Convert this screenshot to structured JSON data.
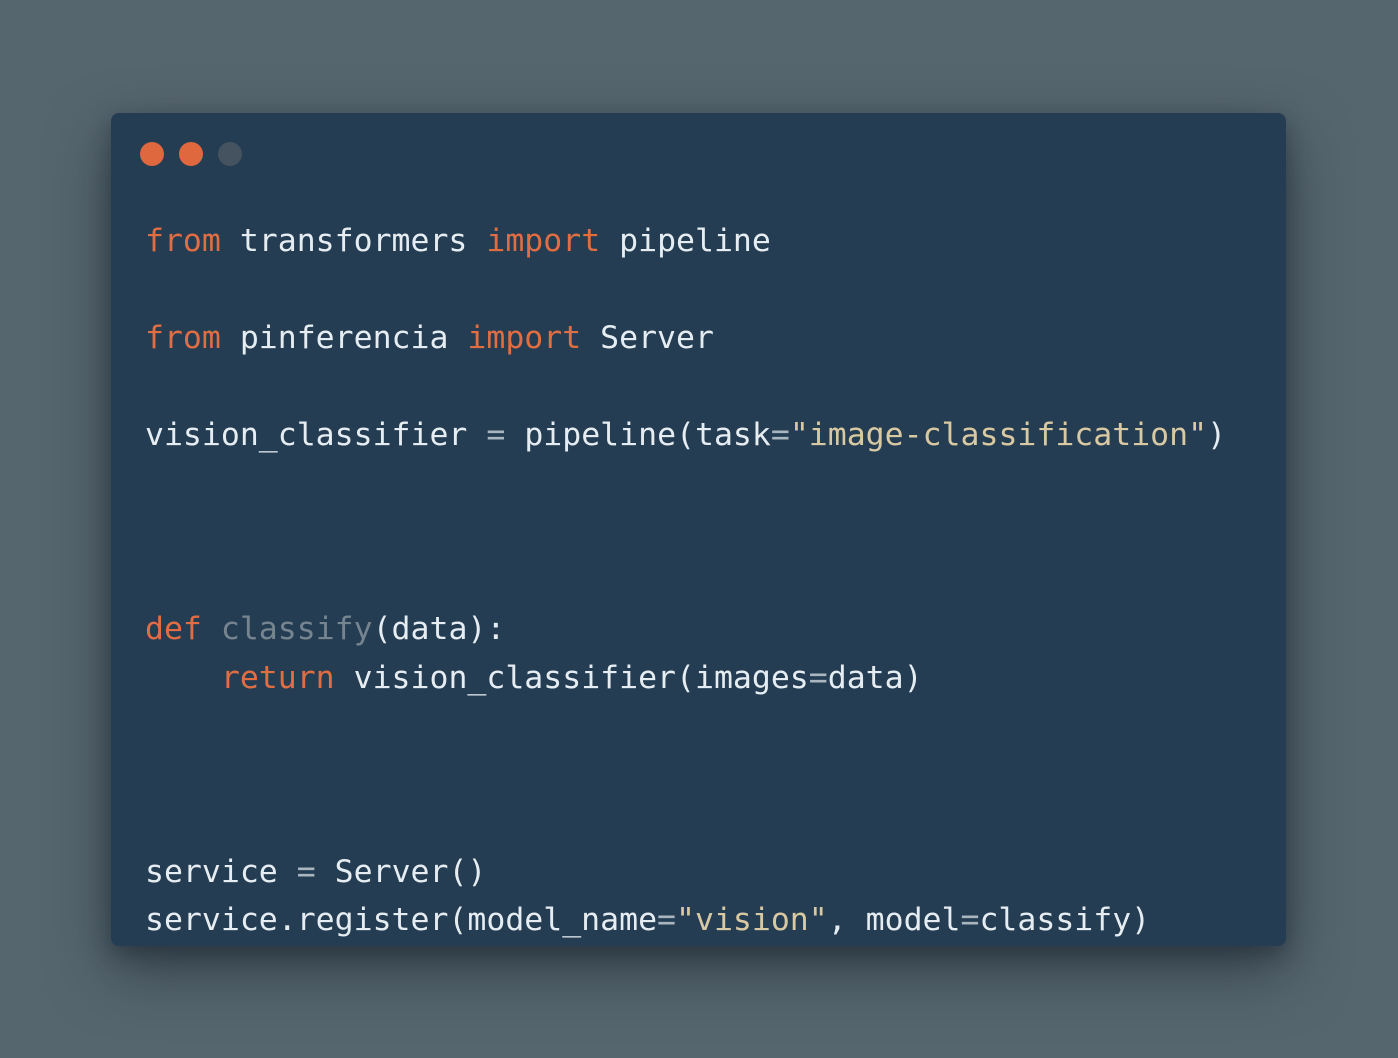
{
  "colors": {
    "background": "#56666f",
    "window": "#243d52",
    "dot_close": "#e0683f",
    "dot_minimize": "#e0683f",
    "dot_maximize": "#44535f",
    "keyword": "#e16d43",
    "function_name": "#75848f",
    "string": "#d9c9a3",
    "text": "#e6edf2"
  },
  "code": {
    "line1": {
      "kw1": "from",
      "mod": " transformers ",
      "kw2": "import",
      "name": " pipeline"
    },
    "line2": {
      "kw1": "from",
      "mod": " pinferencia ",
      "kw2": "import",
      "name": " Server"
    },
    "line3": {
      "var": "vision_classifier",
      "eq": " = ",
      "call": "pipeline(task",
      "eq2": "=",
      "str": "\"image-classification\"",
      "close": ")"
    },
    "line4": {
      "kw": "def",
      "sp": " ",
      "fn": "classify",
      "rest": "(data):"
    },
    "line5": {
      "indent": "    ",
      "kw": "return",
      "call": " vision_classifier(images",
      "eq": "=",
      "rest": "data)"
    },
    "line6": {
      "var": "service",
      "eq": " = ",
      "rest": "Server()"
    },
    "line7": {
      "call": "service.register(model_name",
      "eq": "=",
      "str": "\"vision\"",
      "mid": ", model",
      "eq2": "=",
      "rest": "classify)"
    }
  }
}
